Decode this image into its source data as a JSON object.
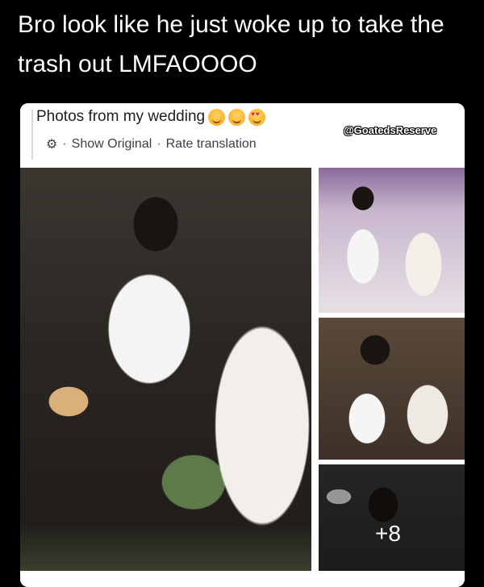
{
  "meme": {
    "caption": "Bro look like he just woke up to take the trash out LMFAOOOO"
  },
  "post": {
    "text": "Photos from my wedding",
    "emojis": [
      "smiling-face-with-hearts",
      "smiling-face-with-hearts",
      "heart-eyes"
    ],
    "meta": {
      "show_original": "Show Original",
      "separator": "·",
      "rate_translation": "Rate translation"
    },
    "watermark": "@GoatedsReserve"
  },
  "photos": {
    "more_count": "+8"
  },
  "colors": {
    "background": "#000000",
    "card": "#ffffff",
    "caption_text": "#ffffff",
    "meta_text": "#3a3f47"
  }
}
